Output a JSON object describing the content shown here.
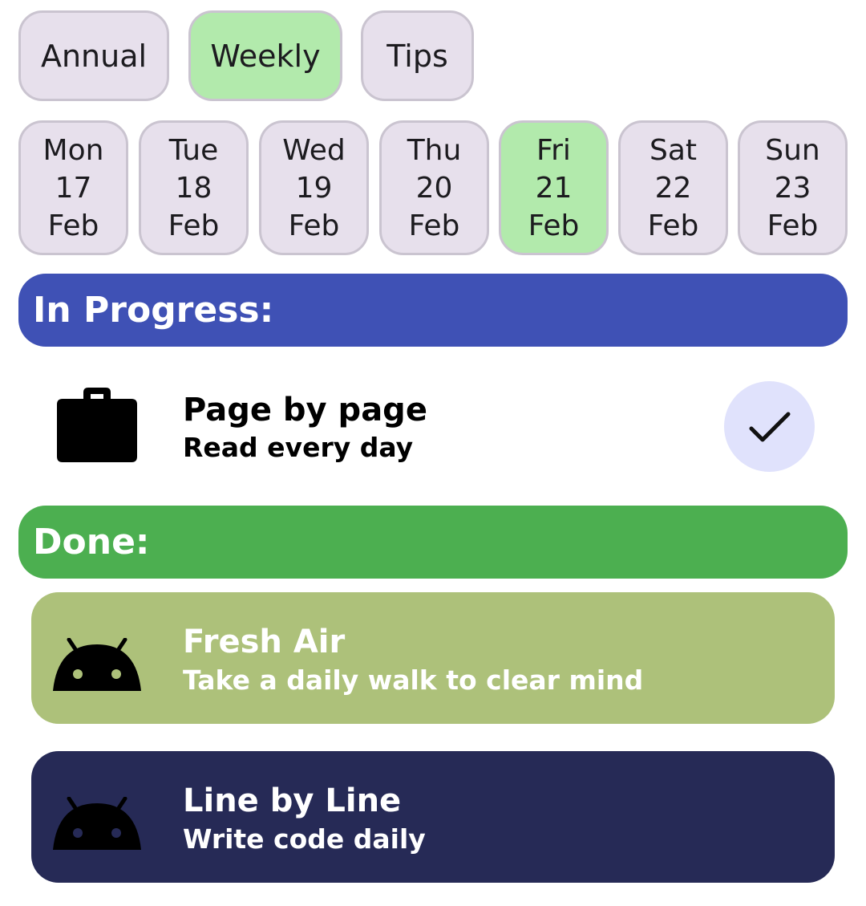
{
  "tabs": [
    {
      "label": "Annual",
      "active": false
    },
    {
      "label": "Weekly",
      "active": true
    },
    {
      "label": "Tips",
      "active": false
    }
  ],
  "days": [
    {
      "weekday": "Mon",
      "date": "17",
      "month": "Feb",
      "active": false
    },
    {
      "weekday": "Tue",
      "date": "18",
      "month": "Feb",
      "active": false
    },
    {
      "weekday": "Wed",
      "date": "19",
      "month": "Feb",
      "active": false
    },
    {
      "weekday": "Thu",
      "date": "20",
      "month": "Feb",
      "active": false
    },
    {
      "weekday": "Fri",
      "date": "21",
      "month": "Feb",
      "active": true
    },
    {
      "weekday": "Sat",
      "date": "22",
      "month": "Feb",
      "active": false
    },
    {
      "weekday": "Sun",
      "date": "23",
      "month": "Feb",
      "active": false
    }
  ],
  "in_progress": {
    "header": "In Progress:",
    "color": "#3f51b5",
    "items": [
      {
        "title": "Page by page",
        "subtitle": "Read every day",
        "icon": "briefcase-icon",
        "action_icon": "check-icon"
      }
    ]
  },
  "done": {
    "header": "Done:",
    "color": "#4caf50",
    "items": [
      {
        "title": "Fresh Air",
        "subtitle": "Take a daily walk to clear mind",
        "icon": "android-icon",
        "card_color": "#adc17a"
      },
      {
        "title": "Line by Line",
        "subtitle": "Write code daily",
        "icon": "android-icon",
        "card_color": "#262a56"
      }
    ]
  },
  "colors": {
    "chip_bg": "#e7e0ec",
    "chip_active_bg": "#b2eaac",
    "check_button_bg": "#e0e2fc"
  }
}
